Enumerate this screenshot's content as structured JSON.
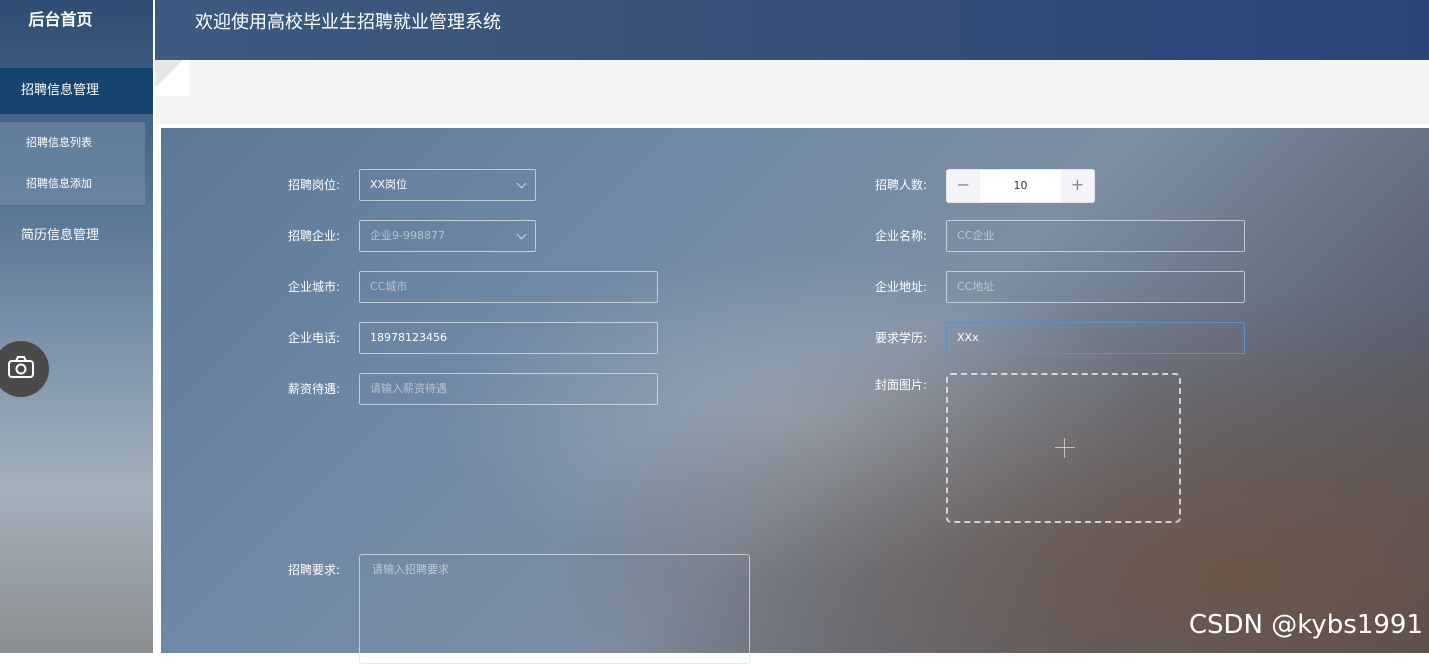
{
  "sidebar": {
    "brand": "后台首页",
    "menu_active": "招聘信息管理",
    "sub_items": [
      "招聘信息列表",
      "招聘信息添加"
    ],
    "menu_item": "简历信息管理"
  },
  "header": {
    "title": "欢迎使用高校毕业生招聘就业管理系统"
  },
  "form": {
    "position_label": "招聘岗位:",
    "position_value": "XX岗位",
    "count_label": "招聘人数:",
    "count_value": "10",
    "company_label": "招聘企业:",
    "company_value": "企业9-998877",
    "company_name_label": "企业名称:",
    "company_name_value": "CC企业",
    "city_label": "企业城市:",
    "city_value": "CC城市",
    "address_label": "企业地址:",
    "address_value": "CC地址",
    "phone_label": "企业电话:",
    "phone_value": "18978123456",
    "education_label": "要求学历:",
    "education_value": "XXx",
    "salary_label": "薪资待遇:",
    "salary_placeholder": "请输入薪资待遇",
    "cover_label": "封面图片:",
    "requirement_label": "招聘要求:",
    "requirement_placeholder": "请输入招聘要求"
  },
  "icons": {
    "camera": "camera-icon",
    "minus": "−",
    "plus": "+"
  },
  "watermark": "CSDN @kybs1991"
}
